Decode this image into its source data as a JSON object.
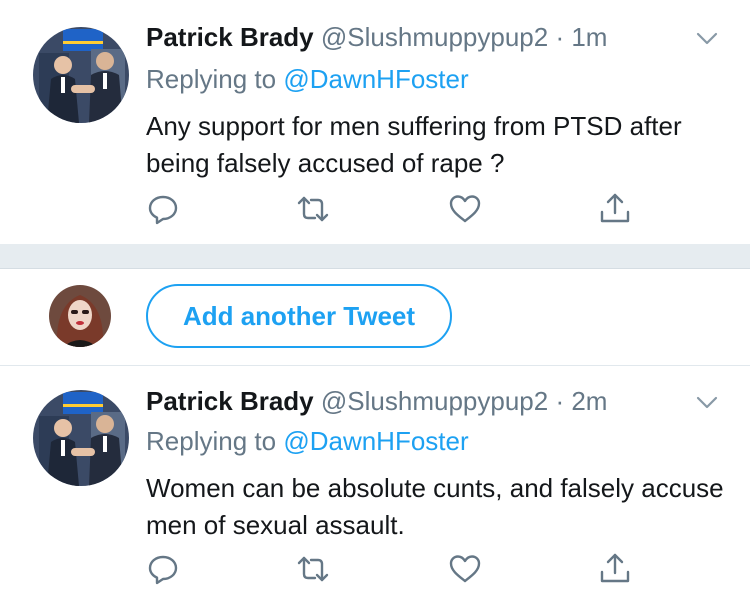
{
  "tweets": [
    {
      "name": "Patrick Brady",
      "handle": "@Slushmuppypup2",
      "separator": "·",
      "time": "1m",
      "replying_prefix": "Replying to",
      "replying_to": "@DawnHFoster",
      "text": "Any support for men suffering from PTSD after being falsely accused of rape ?"
    },
    {
      "name": "Patrick Brady",
      "handle": "@Slushmuppypup2",
      "separator": "·",
      "time": "2m",
      "replying_prefix": "Replying to",
      "replying_to": "@DawnHFoster",
      "text": "Women can be absolute cunts,  and falsely accuse men of sexual assault."
    }
  ],
  "compose": {
    "add_label": "Add another Tweet"
  },
  "icons": {
    "reply": "reply-icon",
    "retweet": "retweet-icon",
    "like": "heart-icon",
    "share": "share-icon",
    "caret": "chevron-down-icon"
  },
  "colors": {
    "accent": "#1da1f2",
    "secondary_text": "#657786",
    "primary_text": "#14171a",
    "separator_bg": "#e6ecf0"
  }
}
